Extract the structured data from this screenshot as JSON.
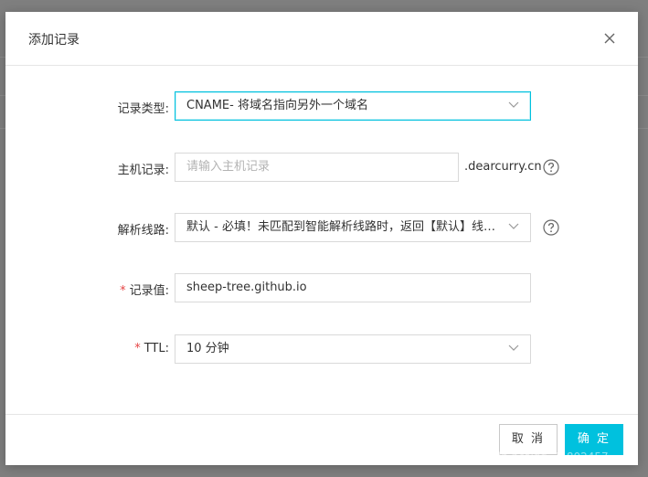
{
  "dialog": {
    "title": "添加记录",
    "close_icon": "close-icon"
  },
  "form": {
    "record_type": {
      "label": "记录类型:",
      "value": "CNAME- 将域名指向另外一个域名"
    },
    "host_record": {
      "label": "主机记录:",
      "placeholder": "请输入主机记录",
      "value": "",
      "suffix": ".dearcurry.cn"
    },
    "resolution_line": {
      "label": "解析线路:",
      "value": "默认 - 必填！未匹配到智能解析线路时，返回【默认】线路..."
    },
    "record_value": {
      "required": "*",
      "label": "记录值:",
      "value": "sheep-tree.github.io"
    },
    "ttl": {
      "required": "*",
      "label": "TTL:",
      "value": "10 分钟"
    }
  },
  "footer": {
    "cancel_label": "取 消",
    "confirm_label": "确 定"
  },
  "watermark": "https://blog.csdn.net/qq_34802457",
  "colors": {
    "accent": "#00c1de",
    "required": "#e54545",
    "overlay": "#7f7f7f"
  }
}
